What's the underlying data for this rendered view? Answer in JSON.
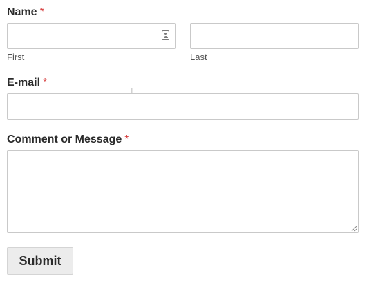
{
  "name_field": {
    "label": "Name",
    "required_mark": "*",
    "first": {
      "value": "",
      "sublabel": "First",
      "icon": "contact-card-icon"
    },
    "last": {
      "value": "",
      "sublabel": "Last"
    }
  },
  "email_field": {
    "label": "E-mail",
    "required_mark": "*",
    "value": ""
  },
  "message_field": {
    "label": "Comment or Message",
    "required_mark": "*",
    "value": ""
  },
  "submit_label": "Submit",
  "colors": {
    "required": "#d63b3b",
    "border": "#c9c9c9",
    "button_bg": "#ececec"
  }
}
